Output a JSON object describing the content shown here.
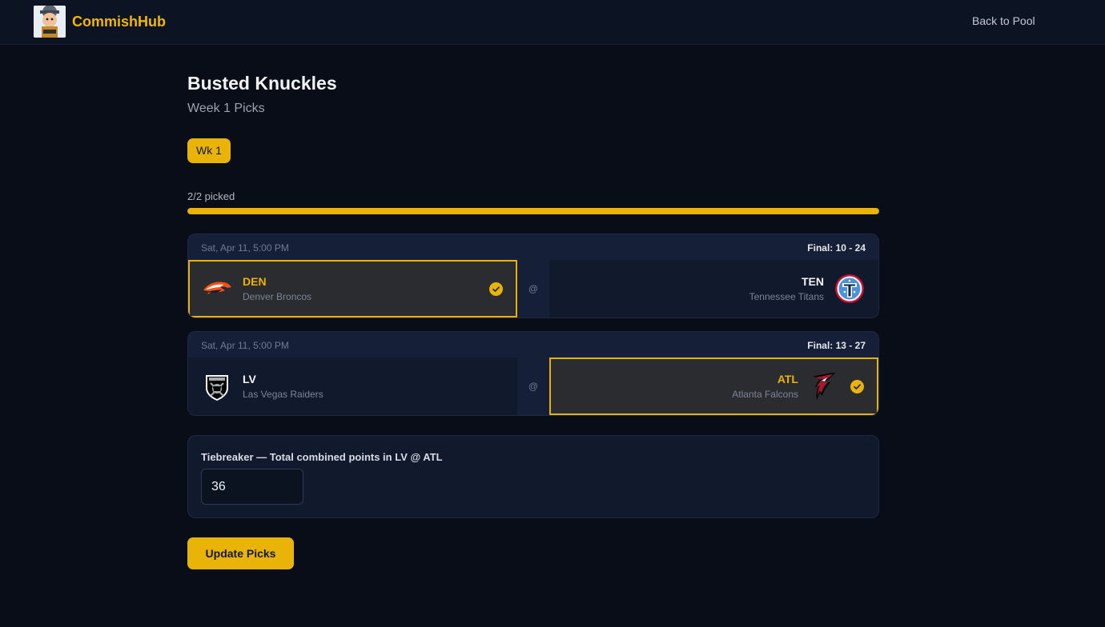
{
  "nav": {
    "brand": "CommishHub",
    "back_link": "Back to Pool"
  },
  "pool": {
    "title": "Busted Knuckles",
    "subtitle": "Week 1 Picks",
    "week_tab": "Wk 1"
  },
  "progress": {
    "label": "2/2 picked",
    "fraction": 1.0
  },
  "games": [
    {
      "time": "Sat, Apr 11, 5:00 PM",
      "final": "Final: 10 - 24",
      "separator": "@",
      "away": {
        "abbr": "DEN",
        "name": "Denver Broncos",
        "logo_icon": "broncos-logo-icon"
      },
      "home": {
        "abbr": "TEN",
        "name": "Tennessee Titans",
        "logo_icon": "titans-logo-icon"
      },
      "picked": "away"
    },
    {
      "time": "Sat, Apr 11, 5:00 PM",
      "final": "Final: 13 - 27",
      "separator": "@",
      "away": {
        "abbr": "LV",
        "name": "Las Vegas Raiders",
        "logo_icon": "raiders-logo-icon"
      },
      "home": {
        "abbr": "ATL",
        "name": "Atlanta Falcons",
        "logo_icon": "falcons-logo-icon"
      },
      "picked": "home"
    }
  ],
  "tiebreaker": {
    "label": "Tiebreaker — Total combined points in LV @ ATL",
    "value": "36"
  },
  "actions": {
    "submit_label": "Update Picks"
  },
  "colors": {
    "accent": "#eab308",
    "background": "#090d17",
    "card": "#152038"
  }
}
